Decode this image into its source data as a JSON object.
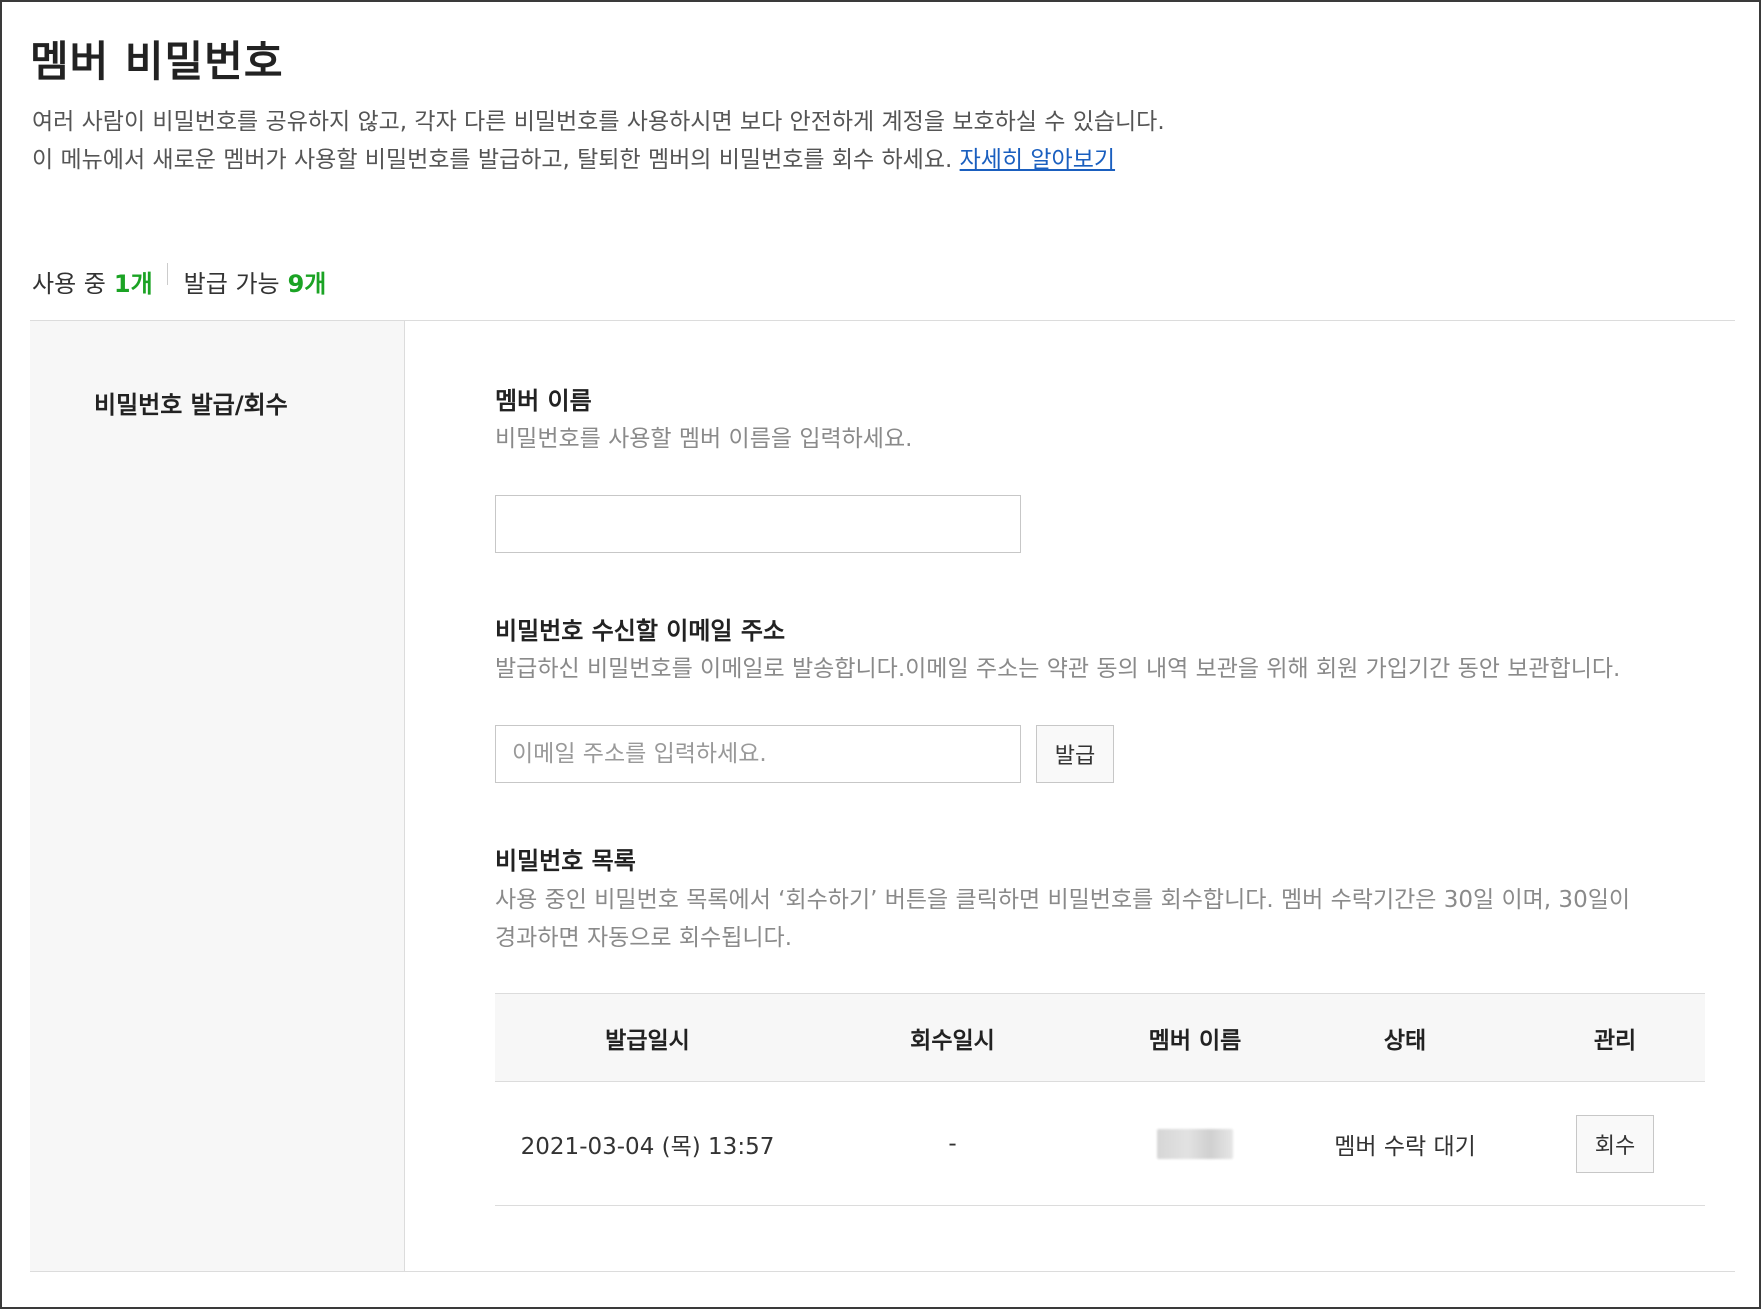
{
  "header": {
    "title": "멤버 비밀번호",
    "desc_line1": "여러 사람이 비밀번호를 공유하지 않고, 각자 다른 비밀번호를 사용하시면 보다 안전하게 계정을 보호하실 수 있습니다.",
    "desc_line2": "이 메뉴에서 새로운 멤버가 사용할 비밀번호를 발급하고, 탈퇴한 멤버의 비밀번호를 회수 하세요.",
    "learn_more": "자세히 알아보기"
  },
  "summary": {
    "in_use_label": "사용 중",
    "in_use_count": "1개",
    "available_label": "발급 가능",
    "available_count": "9개",
    "count_color": "#1ba324"
  },
  "panel": {
    "side_title": "비밀번호 발급/회수",
    "member_name": {
      "title": "멤버 이름",
      "help": "비밀번호를 사용할 멤버 이름을 입력하세요.",
      "value": "",
      "placeholder": ""
    },
    "email": {
      "title": "비밀번호 수신할 이메일 주소",
      "help": "발급하신 비밀번호를 이메일로 발송합니다.이메일 주소는 약관 동의 내역 보관을 위해 회원 가입기간 동안 보관합니다.",
      "value": "",
      "placeholder": "이메일 주소를 입력하세요.",
      "issue_button": "발급"
    },
    "list": {
      "title": "비밀번호 목록",
      "help_line1": "사용 중인 비밀번호 목록에서 ‘회수하기’ 버튼을 클릭하면 비밀번호를 회수합니다. 멤버 수락기간은 30일 이며, 30일이",
      "help_line2": "경과하면 자동으로 회수됩니다.",
      "columns": [
        "발급일시",
        "회수일시",
        "멤버 이름",
        "상태",
        "관리"
      ],
      "rows": [
        {
          "issued_at": "2021-03-04 (목) 13:57",
          "revoked_at": "-",
          "member_name": "",
          "status": "멤버 수락 대기",
          "action": "회수"
        }
      ]
    }
  },
  "colors": {
    "link": "#1a5fbf",
    "side_bg": "#f7f7f7",
    "border": "#dcdcdc"
  }
}
